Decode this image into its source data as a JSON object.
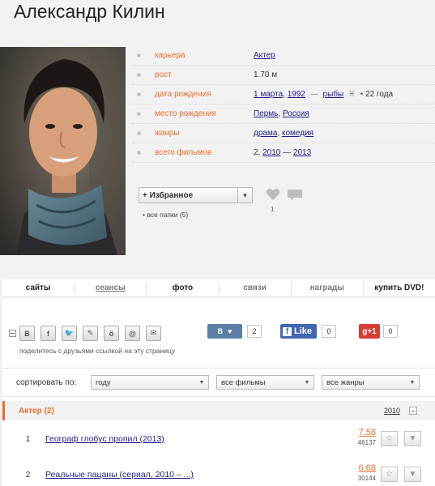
{
  "title": "Александр Килин",
  "info": {
    "rows": [
      {
        "label": "карьера",
        "value": "Актер"
      },
      {
        "label": "рост",
        "value": "1.70 м"
      },
      {
        "label": "дата рождения",
        "date": "1 марта",
        "year": "1992",
        "sign": "рыбы",
        "age": "22 года"
      },
      {
        "label": "место рождения",
        "city": "Пермь",
        "country": "Россия"
      },
      {
        "label": "жанры",
        "g1": "драма",
        "g2": "комедия"
      },
      {
        "label": "всего фильмов",
        "count": "2,",
        "from": "2010",
        "dash": "—",
        "to": "2013"
      }
    ]
  },
  "favorites": {
    "label": "+ Избранное",
    "all_folders": "все папки (5)"
  },
  "likes": {
    "count": "1"
  },
  "tabs": [
    "сайты",
    "сеансы",
    "фото",
    "связи",
    "награды",
    "купить DVD!"
  ],
  "share": {
    "caption": "поделитесь с друзьями ссылкой на эту страницу",
    "vk_count": "2",
    "fb_label": "Like",
    "fb_count": "0",
    "gp_label": "g+1",
    "gp_count": "0"
  },
  "sort": {
    "label": "сортировать по:",
    "by": "году",
    "films": "все фильмы",
    "genres": "все жанры"
  },
  "section": {
    "title": "Актер (2)",
    "year": "2010"
  },
  "films": [
    {
      "num": "1",
      "title": "Географ глобус пропил (2013)",
      "rating": "7.58",
      "votes": "46137"
    },
    {
      "num": "2",
      "title": "Реальные пацаны (сериал, 2010 – ...)",
      "rating": "6.68",
      "votes": "30144"
    }
  ],
  "colors": {
    "accent": "#f06d2c",
    "link": "#1e1e8a",
    "vk": "#5b7fa6",
    "facebook": "#4267b2",
    "gplus": "#d73d32"
  }
}
